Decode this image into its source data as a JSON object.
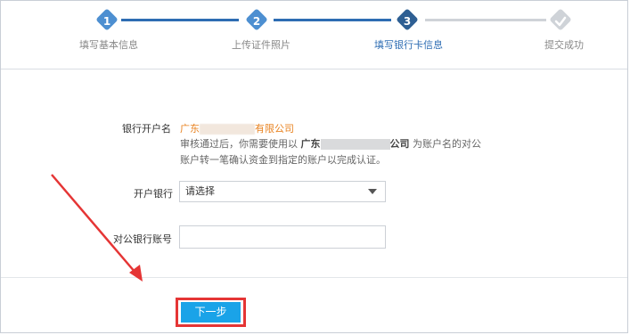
{
  "steps": [
    {
      "num": "1",
      "label": "填写基本信息",
      "state": "done"
    },
    {
      "num": "2",
      "label": "上传证件照片",
      "state": "done"
    },
    {
      "num": "3",
      "label": "填写银行卡信息",
      "state": "active"
    },
    {
      "num": "",
      "label": "提交成功",
      "state": "todo"
    }
  ],
  "form": {
    "account_name_label": "银行开户名",
    "company_prefix": "广东",
    "company_suffix": "有限公司",
    "note_before": "审核通过后，你需要使用以 ",
    "note_company_prefix": "广东",
    "note_company_suffix": "公司",
    "note_after": " 为账户名的对公账户转一笔确认资金到指定的账户以完成认证。",
    "bank_label": "开户银行",
    "bank_selected": "请选择",
    "account_label": "对公银行账号",
    "account_value": ""
  },
  "actions": {
    "next_label": "下一步"
  },
  "colors": {
    "accent": "#1aa3e8",
    "step_active": "#2e5f93",
    "warning_text": "#e8811e",
    "highlight": "#e53535"
  }
}
